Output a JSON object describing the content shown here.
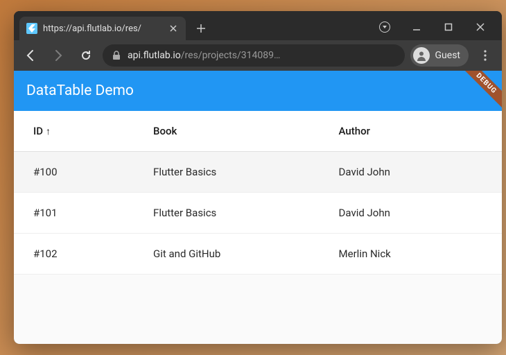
{
  "browser": {
    "tab_title": "https://api.flutlab.io/res/",
    "url_domain": "api.flutlab.io",
    "url_path": "/res/projects/314089…",
    "guest_label": "Guest"
  },
  "app": {
    "title": "DataTable Demo",
    "debug_label": "DEBUG"
  },
  "table": {
    "columns": {
      "id": "ID",
      "book": "Book",
      "author": "Author"
    },
    "sort_column": "id",
    "sort_dir": "asc",
    "rows": [
      {
        "id": "#100",
        "book": "Flutter Basics",
        "author": "David John",
        "selected": true
      },
      {
        "id": "#101",
        "book": "Flutter Basics",
        "author": "David John",
        "selected": false
      },
      {
        "id": "#102",
        "book": "Git and GitHub",
        "author": "Merlin Nick",
        "selected": false
      }
    ]
  }
}
